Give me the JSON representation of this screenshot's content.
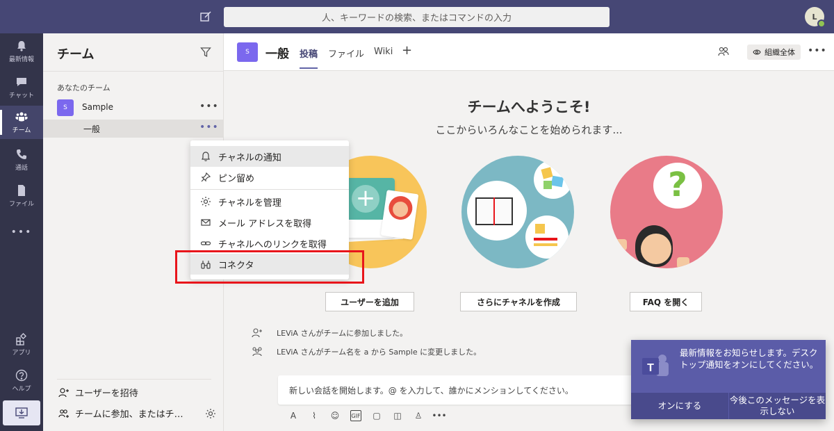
{
  "topbar": {
    "search_placeholder": "人、キーワードの検索、またはコマンドの入力",
    "avatar_initial": "L"
  },
  "rail": {
    "items": [
      {
        "label": "最新情報",
        "icon": "bell-icon"
      },
      {
        "label": "チャット",
        "icon": "chat-icon"
      },
      {
        "label": "チーム",
        "icon": "teams-icon",
        "active": true
      },
      {
        "label": "通話",
        "icon": "phone-icon"
      },
      {
        "label": "ファイル",
        "icon": "file-icon"
      },
      {
        "label": "•••",
        "icon": "more-icon"
      }
    ],
    "apps_label": "アプリ",
    "help_label": "ヘルプ"
  },
  "panel": {
    "title": "チーム",
    "section_label": "あなたのチーム",
    "team": {
      "initial": "S",
      "name": "Sample"
    },
    "channel": "一般",
    "invite_label": "ユーザーを招待",
    "join_label": "チームに参加、またはチ…"
  },
  "header": {
    "channel_initial": "S",
    "channel_title": "一般",
    "tabs": [
      "投稿",
      "ファイル",
      "Wiki"
    ],
    "add_tab": "+",
    "org_badge": "組織全体"
  },
  "welcome": {
    "title": "チームへようこそ!",
    "subtitle": "ここからいろんなことを始められます...",
    "buttons": [
      "ユーザーを追加",
      "さらにチャネルを作成",
      "FAQ を開く"
    ]
  },
  "feed": [
    "LEViA さんがチームに参加しました。",
    "LEViA さんがチーム名を a から Sample に変更しました。"
  ],
  "compose": {
    "placeholder": "新しい会話を開始します。@ を入力して、誰かにメンションしてください。"
  },
  "context_menu": {
    "items": [
      {
        "label": "チャネルの通知",
        "icon": "bell-icon"
      },
      {
        "label": "ピン留め",
        "icon": "pin-icon"
      },
      {
        "label": "チャネルを管理",
        "icon": "gear-icon"
      },
      {
        "label": "メール アドレスを取得",
        "icon": "mail-icon"
      },
      {
        "label": "チャネルへのリンクを取得",
        "icon": "link-icon"
      },
      {
        "label": "コネクタ",
        "icon": "connector-icon"
      }
    ]
  },
  "toast": {
    "message": "最新情報をお知らせします。デスクトップ通知をオンにしてください。",
    "enable_label": "オンにする",
    "dismiss_label": "今後このメッセージを表示しない"
  },
  "colors": {
    "brand": "#464775",
    "rail": "#33344a",
    "accent": "#6264a7",
    "highlight": "#e8151b"
  }
}
